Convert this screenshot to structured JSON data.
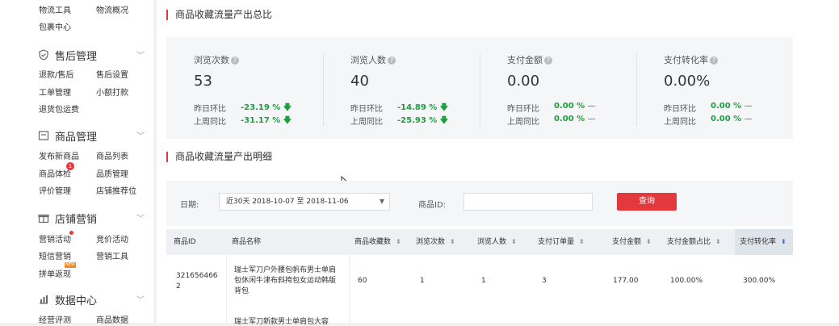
{
  "sidebar": {
    "top_items": [
      "物流工具",
      "物流概况",
      "包裹中心"
    ],
    "sections": [
      {
        "title": "售后管理",
        "icon": "shield-icon",
        "items": [
          "退款/售后",
          "售后设置",
          "工单管理",
          "小额打款",
          "退货包运费"
        ]
      },
      {
        "title": "商品管理",
        "icon": "product-icon",
        "items": [
          "发布新商品",
          "商品列表",
          "商品体检",
          "品质管理",
          "评价管理",
          "店铺推荐位"
        ]
      },
      {
        "title": "店铺营销",
        "icon": "gift-icon",
        "items": [
          "营销活动",
          "竞价活动",
          "短信营销",
          "营销工具",
          "拼单返现"
        ]
      },
      {
        "title": "数据中心",
        "icon": "chart-icon",
        "items": [
          "经营评测",
          "商品数据"
        ]
      }
    ],
    "badge_text": "1",
    "new_tag": "NEW"
  },
  "summary": {
    "title": "商品收藏流量产出总比",
    "stats": [
      {
        "label": "浏览次数",
        "value": "53",
        "dod_label": "昨日环比",
        "dod": "-23.19 %",
        "dod_icon": "arrow-down",
        "wow_label": "上周同比",
        "wow": "-31.17 %",
        "wow_icon": "arrow-down"
      },
      {
        "label": "浏览人数",
        "value": "40",
        "dod_label": "昨日环比",
        "dod": "-14.89 %",
        "dod_icon": "arrow-down",
        "wow_label": "上周同比",
        "wow": "-25.93 %",
        "wow_icon": "arrow-down"
      },
      {
        "label": "支付金额",
        "value": "0.00",
        "dod_label": "昨日环比",
        "dod": "0.00 %",
        "dod_icon": "dash",
        "wow_label": "上周同比",
        "wow": "0.00 %",
        "wow_icon": "dash"
      },
      {
        "label": "支付转化率",
        "value": "0.00%",
        "dod_label": "昨日环比",
        "dod": "0.00 %",
        "dod_icon": "dash",
        "wow_label": "上周同比",
        "wow": "0.00 %",
        "wow_icon": "dash"
      }
    ]
  },
  "detail": {
    "title": "商品收藏流量产出明细",
    "date_label": "日期:",
    "date_value": "近30天  2018-10-07 至 2018-11-06",
    "product_id_label": "商品ID:",
    "product_id_value": "",
    "query_button": "查询",
    "columns": [
      "商品ID",
      "商品名称",
      "商品收藏数",
      "浏览次数",
      "浏览人数",
      "支付订单量",
      "支付金额",
      "支付金额占比",
      "支付转化率"
    ],
    "rows": [
      {
        "id_line1": "321656466",
        "id_line2": "2",
        "name_lines": [
          "瑞士军刀户外腰包帆布男士单肩",
          "包休闲牛津布斜挎包女运动韩版",
          "背包"
        ],
        "favs": "60",
        "views": "1",
        "visitors": "1",
        "orders": "3",
        "amount": "177.00",
        "amount_share": "100.00%",
        "conversion": "300.00%"
      }
    ],
    "partial_row_name": "瑞士军刀新款男士单肩包大容"
  },
  "colors": {
    "accent": "#e4393c",
    "positive": "#1e9e3d"
  }
}
